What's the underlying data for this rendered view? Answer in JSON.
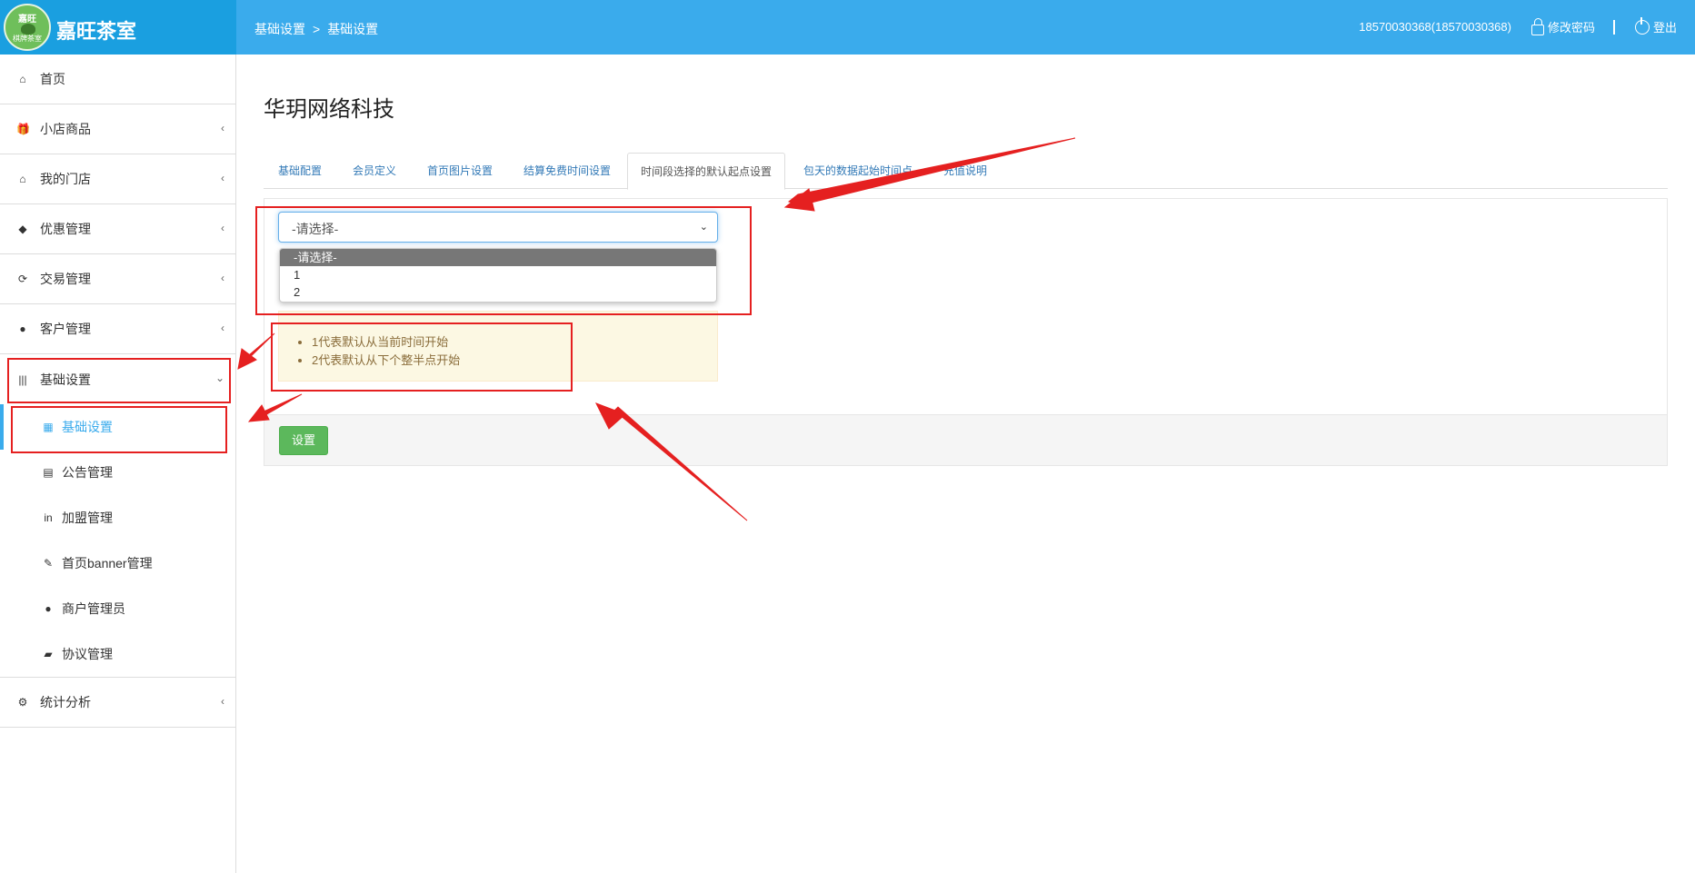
{
  "header": {
    "brand_name": "嘉旺茶室",
    "logo_text_top": "嘉旺",
    "logo_text_bottom": "棋牌茶室",
    "breadcrumb": [
      "基础设置",
      "基础设置"
    ],
    "breadcrumb_sep": ">",
    "user": "18570030368(18570030368)",
    "change_password": "修改密码",
    "logout": "登出",
    "bg_color": "#3aabec"
  },
  "sidebar": {
    "items": [
      {
        "label": "首页",
        "icon": "home-icon",
        "glyph": "⌂"
      },
      {
        "label": "小店商品",
        "icon": "gift-icon",
        "glyph": "🎁",
        "chevron": "‹"
      },
      {
        "label": "我的门店",
        "icon": "home-icon",
        "glyph": "⌂",
        "chevron": "‹"
      },
      {
        "label": "优惠管理",
        "icon": "tags-icon",
        "glyph": "◆",
        "chevron": "‹"
      },
      {
        "label": "交易管理",
        "icon": "refresh-icon",
        "glyph": "⟳",
        "chevron": "‹"
      },
      {
        "label": "客户管理",
        "icon": "user-icon",
        "glyph": "●",
        "chevron": "‹"
      },
      {
        "label": "基础设置",
        "icon": "barcode-icon",
        "glyph": "|||",
        "chevron": "⌄"
      }
    ],
    "sub_items": [
      {
        "label": "基础设置",
        "icon": "qrcode-icon",
        "glyph": "▦"
      },
      {
        "label": "公告管理",
        "icon": "list-icon",
        "glyph": "▤"
      },
      {
        "label": "加盟管理",
        "icon": "linkedin-icon",
        "glyph": "in"
      },
      {
        "label": "首页banner管理",
        "icon": "pen-icon",
        "glyph": "✎"
      },
      {
        "label": "商户管理员",
        "icon": "user-icon",
        "glyph": "●"
      },
      {
        "label": "协议管理",
        "icon": "book-icon",
        "glyph": "▰"
      }
    ],
    "last_item": {
      "label": "统计分析",
      "icon": "gear-icon",
      "glyph": "⚙",
      "chevron": "‹"
    }
  },
  "main": {
    "title": "华玥网络科技",
    "tabs": [
      "基础配置",
      "会员定义",
      "首页图片设置",
      "结算免费时间设置",
      "时间段选择的默认起点设置",
      "包天的数据起始时间点",
      "充值说明"
    ],
    "active_tab": 4,
    "select": {
      "value": "-请选择-",
      "options": [
        "-请选择-",
        "1",
        "2"
      ]
    },
    "hints": [
      "1代表默认从当前时间开始",
      "2代表默认从下个整半点开始"
    ],
    "submit_label": "设置"
  }
}
